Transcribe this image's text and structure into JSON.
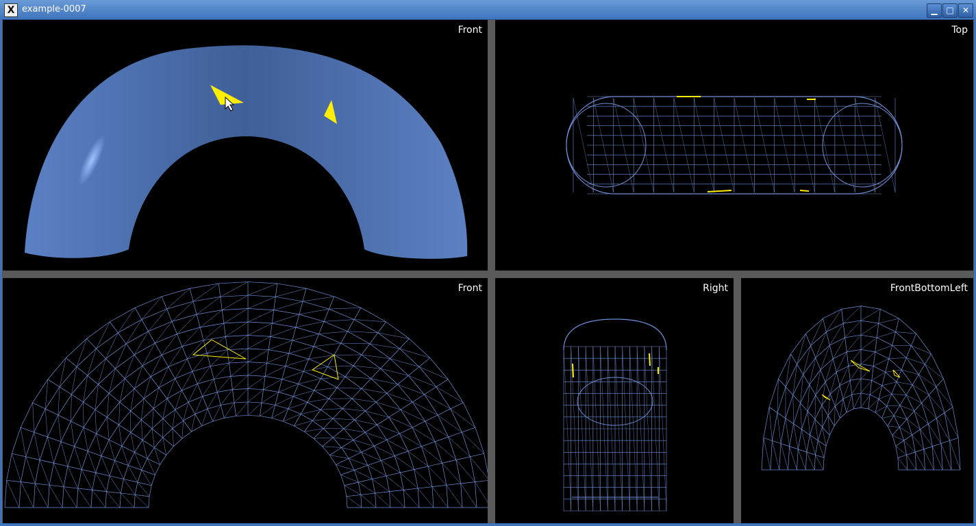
{
  "window": {
    "title": "example-0007",
    "icon": "x-app-icon",
    "buttons": {
      "minimize": "▁",
      "maximize": "□",
      "close": "✕"
    }
  },
  "viewports": [
    {
      "label": "Front",
      "mode": "shaded"
    },
    {
      "label": "Top",
      "mode": "wireframe"
    },
    {
      "label": "Front",
      "mode": "wireframe"
    },
    {
      "label": "Right",
      "mode": "wireframe"
    },
    {
      "label": "FrontBottomLeft",
      "mode": "wireframe"
    }
  ],
  "colors": {
    "mesh": "#6f8fd8",
    "surface": "#4a6eaa",
    "marker": "#ffee00",
    "background": "#000000"
  }
}
